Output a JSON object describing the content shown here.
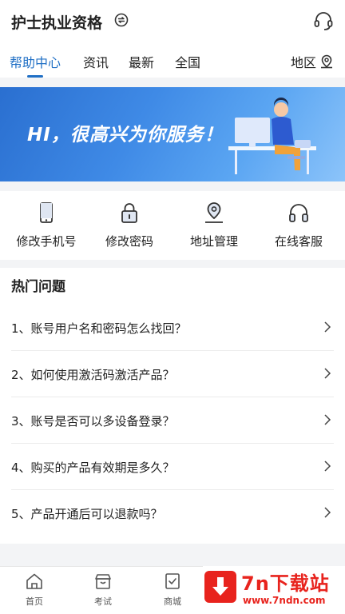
{
  "header": {
    "title": "护士执业资格"
  },
  "tabs": [
    {
      "label": "帮助中心"
    },
    {
      "label": "资讯"
    },
    {
      "label": "最新"
    },
    {
      "label": "全国"
    }
  ],
  "region_label": "地区",
  "banner": {
    "text": "HI，很高兴为你服务！"
  },
  "quick_actions": [
    {
      "label": "修改手机号",
      "icon": "phone-icon"
    },
    {
      "label": "修改密码",
      "icon": "lock-icon"
    },
    {
      "label": "地址管理",
      "icon": "location-icon"
    },
    {
      "label": "在线客服",
      "icon": "headphones-icon"
    }
  ],
  "faq": {
    "title": "热门问题",
    "items": [
      "1、账号用户名和密码怎么找回？",
      "2、如何使用激活码激活产品？",
      "3、账号是否可以多设备登录？",
      "4、购买的产品有效期是多久？",
      "5、产品开通后可以退款吗？"
    ]
  },
  "bottom_nav": [
    {
      "label": "首页",
      "icon": "home-icon"
    },
    {
      "label": "考试",
      "icon": "exam-icon"
    },
    {
      "label": "商城",
      "icon": "shop-icon"
    }
  ],
  "watermark": {
    "title": "7n下载站",
    "url": "www.7ndn.com"
  },
  "colors": {
    "accent": "#1f6fc5",
    "watermark": "#e8231d"
  }
}
